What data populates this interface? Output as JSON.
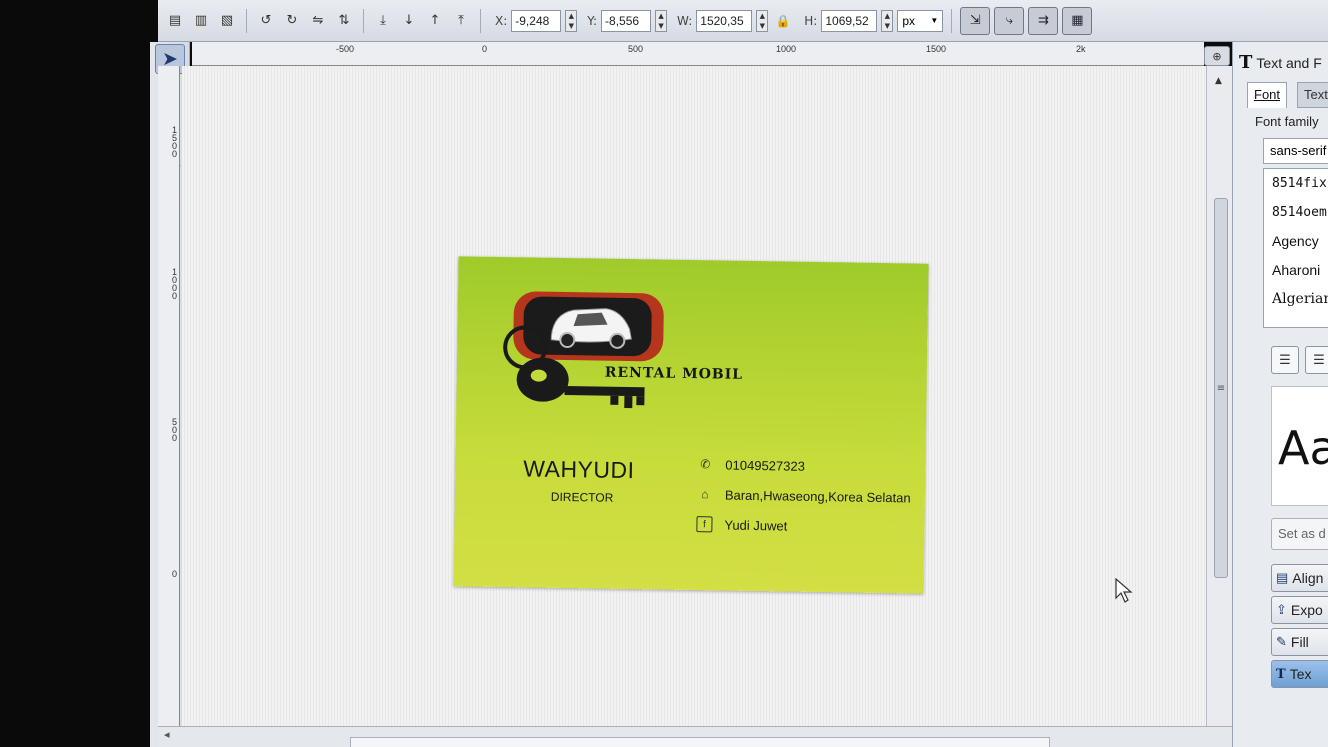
{
  "toolbar": {
    "x_label": "X:",
    "x_value": "-9,248",
    "y_label": "Y:",
    "y_value": "-8,556",
    "w_label": "W:",
    "w_value": "1520,35",
    "h_label": "H:",
    "h_value": "1069,52",
    "unit": "px"
  },
  "hruler": {
    "ticks": [
      "-500",
      "0",
      "500",
      "1000",
      "1500",
      "2k"
    ]
  },
  "vruler": {
    "ticks": [
      "1500",
      "1000",
      "500",
      "0"
    ]
  },
  "card": {
    "brand": "RENTAL MOBIL",
    "name": "WAHYUDI",
    "title": "DIRECTOR",
    "phone": "01049527323",
    "address": "Baran,Hwaseong,Korea Selatan",
    "facebook": "Yudi Juwet"
  },
  "panel": {
    "title": "Text and F",
    "tabs": [
      "Font",
      "Text"
    ],
    "font_family_label": "Font family",
    "font_search": "sans-serif",
    "fonts": [
      "8514fix",
      "8514oem",
      "Agency",
      "Aharoni",
      "Algerian"
    ],
    "preview": "Aa",
    "set_default": "Set as d",
    "buttons": [
      "Align",
      "Expo",
      "Fill",
      "Tex"
    ]
  },
  "colors": {
    "card_green_top": "#9fcb2a",
    "card_green_bottom": "#d3df44",
    "logo_red": "#b5351d",
    "selected_blue": "#6f9fd5"
  }
}
